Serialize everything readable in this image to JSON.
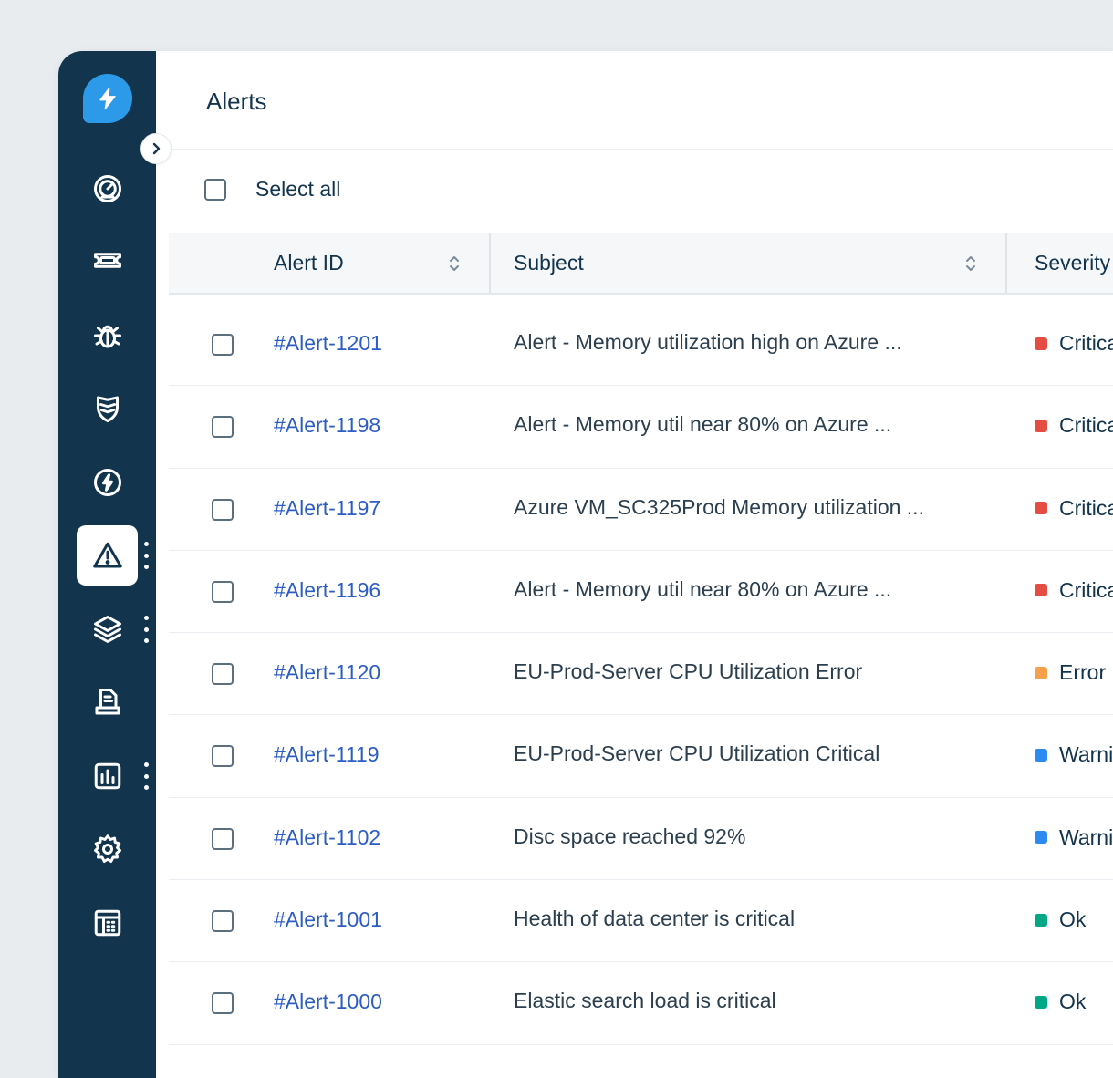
{
  "page": {
    "title": "Alerts"
  },
  "select_all": {
    "label": "Select all"
  },
  "table": {
    "columns": [
      {
        "label": "Alert ID",
        "sortable": true
      },
      {
        "label": "Subject",
        "sortable": true
      },
      {
        "label": "Severity",
        "sortable": false
      }
    ],
    "rows": [
      {
        "id": "#Alert-1201",
        "subject": "Alert - Memory utilization high on Azure ...",
        "severity": "Critical",
        "severity_color": "#e54d42"
      },
      {
        "id": "#Alert-1198",
        "subject": "Alert - Memory util near 80% on Azure ...",
        "severity": "Critical",
        "severity_color": "#e54d42"
      },
      {
        "id": "#Alert-1197",
        "subject": "Azure VM_SC325Prod Memory utilization ...",
        "severity": "Critical",
        "severity_color": "#e54d42"
      },
      {
        "id": "#Alert-1196",
        "subject": "Alert - Memory util near 80% on Azure ...",
        "severity": "Critical",
        "severity_color": "#e54d42"
      },
      {
        "id": "#Alert-1120",
        "subject": "EU-Prod-Server CPU Utilization Error",
        "severity": "Error",
        "severity_color": "#f5a04a"
      },
      {
        "id": "#Alert-1119",
        "subject": "EU-Prod-Server CPU Utilization Critical",
        "severity": "Warning",
        "severity_color": "#2c8af0"
      },
      {
        "id": "#Alert-1102",
        "subject": "Disc space reached 92%",
        "severity": "Warning",
        "severity_color": "#2c8af0"
      },
      {
        "id": "#Alert-1001",
        "subject": "Health of data center is critical",
        "severity": "Ok",
        "severity_color": "#00a886"
      },
      {
        "id": "#Alert-1000",
        "subject": "Elastic search load is critical",
        "severity": "Ok",
        "severity_color": "#00a886"
      }
    ]
  },
  "sidebar": {
    "logo_icon": "lightning-bolt-icon",
    "items": [
      {
        "name": "dashboard",
        "icon": "gauge-icon",
        "active": false
      },
      {
        "name": "tickets",
        "icon": "ticket-icon",
        "active": false
      },
      {
        "name": "problems",
        "icon": "bug-icon",
        "active": false
      },
      {
        "name": "changes",
        "icon": "shield-icon",
        "active": false
      },
      {
        "name": "releases",
        "icon": "bolt-circle-icon",
        "active": false
      },
      {
        "name": "alerts",
        "icon": "warning-icon",
        "active": true
      },
      {
        "name": "assets",
        "icon": "layers-icon",
        "active": false
      },
      {
        "name": "solutions",
        "icon": "document-icon",
        "active": false
      },
      {
        "name": "analytics",
        "icon": "bar-chart-icon",
        "active": false
      },
      {
        "name": "admin",
        "icon": "gear-icon",
        "active": false
      },
      {
        "name": "calendar",
        "icon": "calendar-icon",
        "active": false
      }
    ]
  },
  "colors": {
    "sidebar_bg": "#12344d",
    "accent": "#2c9ae8",
    "link": "#2c5cc5"
  }
}
